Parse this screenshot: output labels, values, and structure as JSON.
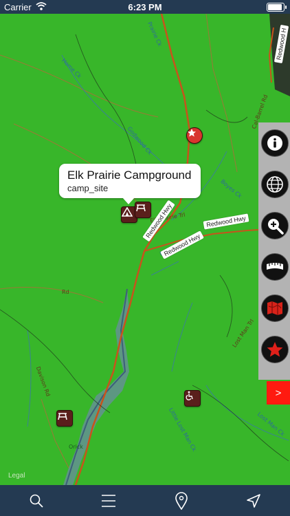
{
  "status_bar": {
    "carrier": "Carrier",
    "time": "6:23 PM"
  },
  "callout": {
    "title": "Elk Prairie Campground",
    "subtitle": "camp_site"
  },
  "map": {
    "legal_label": "Legal",
    "roads": [
      {
        "key": "redwood_hwy_1",
        "label": "Redwood Hwy"
      },
      {
        "key": "redwood_hwy_2",
        "label": "Redwood Hwy"
      },
      {
        "key": "redwood_hwy_3",
        "label": "Redwood Hwy"
      },
      {
        "key": "redwood_hwy_4",
        "label": "Redwood H"
      }
    ],
    "labels": {
      "cal_barrel_rd": "Cal-Barrel Rd",
      "boyes_ck": "Boyes Ck",
      "may_ck": "May Ck",
      "lost_man_trl": "Lost Man Trl",
      "lost_man_ck": "Lost Man Ck",
      "little_lost_man_ck": "Little Lost Man Ck",
      "davison_rd": "Davison Rd",
      "elk_prairie_trl": "Elk Prairie Trl",
      "godwood_ck": "Godwood Ck",
      "home_ck": "Home Ck",
      "prairie_ck": "Prairie Ck",
      "rd": "Rd",
      "boyes_creek": "Boyes Ck",
      "orick": "Orick"
    }
  },
  "side_panel": {
    "buttons": [
      "info",
      "map-layers",
      "zoom-in",
      "measure",
      "map-style",
      "favorites"
    ],
    "expand_label": ">"
  },
  "toolbar": {
    "buttons": [
      "search",
      "menu",
      "location-pin",
      "navigate"
    ]
  },
  "colors": {
    "map_green": "#38b62a",
    "bar": "#243a52",
    "poi": "#5a1f1c",
    "accent_red": "#ff1a10"
  }
}
